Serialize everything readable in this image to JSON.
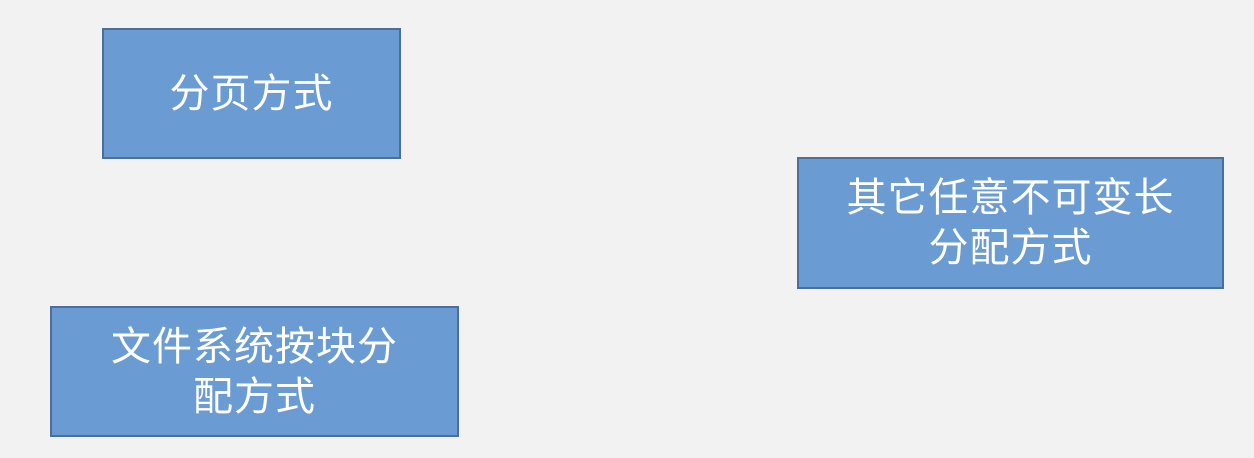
{
  "boxes": [
    {
      "lines": [
        "分页方式"
      ]
    },
    {
      "lines": [
        "其它任意不可变长",
        "分配方式"
      ]
    },
    {
      "lines": [
        "文件系统按块分",
        "配方式"
      ]
    }
  ]
}
